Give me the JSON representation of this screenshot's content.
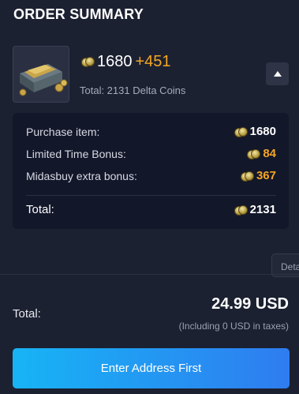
{
  "summary": {
    "title": "ORDER SUMMARY"
  },
  "product": {
    "base_amount": "1680",
    "bonus_amount": "+451",
    "total_label": "Total: 2131 Delta Coins"
  },
  "breakdown": {
    "rows": [
      {
        "label": "Purchase item:",
        "value": "1680",
        "color": "#ffffff"
      },
      {
        "label": "Limited Time Bonus:",
        "value": "84",
        "color": "#f5a623"
      },
      {
        "label": "Midasbuy extra bonus:",
        "value": "367",
        "color": "#f5a623"
      }
    ],
    "total": {
      "label": "Total:",
      "value": "2131"
    }
  },
  "details_tab": {
    "label": "Deta"
  },
  "payment": {
    "total_label": "Total:",
    "price": "24.99 USD",
    "tax_note": "(Including 0 USD in taxes)"
  },
  "cta": {
    "label": "Enter Address First"
  },
  "icons": {
    "coin": "delta-coin-icon",
    "product": "coin-chest-image",
    "collapse": "chevron-up-icon"
  },
  "colors": {
    "accent_orange": "#f5a623",
    "button_start": "#17b4f5",
    "button_end": "#2f7cf0"
  }
}
